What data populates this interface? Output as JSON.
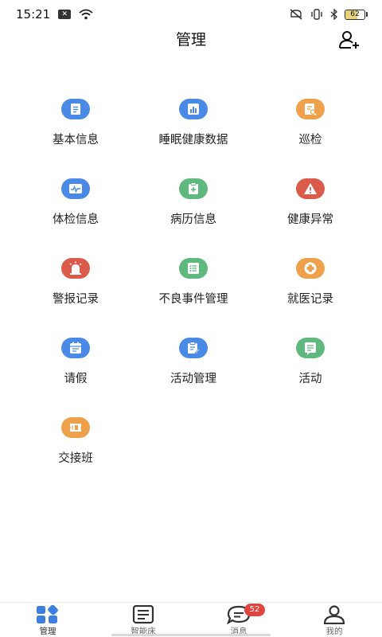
{
  "status": {
    "time": "15:21",
    "battery": "62",
    "battery_level": 0.62
  },
  "header": {
    "title": "管理"
  },
  "colors": {
    "blue": "#4a8ae6",
    "orange": "#efa04a",
    "green": "#5fb97f",
    "red": "#db5b4b"
  },
  "menu": [
    {
      "label": "基本信息",
      "icon": "document-icon",
      "color": "blue"
    },
    {
      "label": "睡眠健康数据",
      "icon": "bar-chart-icon",
      "color": "blue"
    },
    {
      "label": "巡检",
      "icon": "inspection-icon",
      "color": "orange"
    },
    {
      "label": "体检信息",
      "icon": "heartbeat-monitor-icon",
      "color": "blue"
    },
    {
      "label": "病历信息",
      "icon": "medical-clipboard-icon",
      "color": "green"
    },
    {
      "label": "健康异常",
      "icon": "warning-icon",
      "color": "red"
    },
    {
      "label": "警报记录",
      "icon": "alarm-light-icon",
      "color": "red"
    },
    {
      "label": "不良事件管理",
      "icon": "list-icon",
      "color": "green"
    },
    {
      "label": "就医记录",
      "icon": "medical-cross-icon",
      "color": "orange"
    },
    {
      "label": "请假",
      "icon": "calendar-icon",
      "color": "blue"
    },
    {
      "label": "活动管理",
      "icon": "clipboard-edit-icon",
      "color": "blue"
    },
    {
      "label": "活动",
      "icon": "message-list-icon",
      "color": "green"
    },
    {
      "label": "交接班",
      "icon": "shift-ticket-icon",
      "color": "orange"
    }
  ],
  "tabs": [
    {
      "label": "管理",
      "icon": "grid-icon",
      "active": true
    },
    {
      "label": "智能床",
      "icon": "bed-list-icon",
      "active": false
    },
    {
      "label": "消息",
      "icon": "chat-icon",
      "active": false,
      "badge": "52"
    },
    {
      "label": "我的",
      "icon": "user-icon",
      "active": false
    }
  ]
}
